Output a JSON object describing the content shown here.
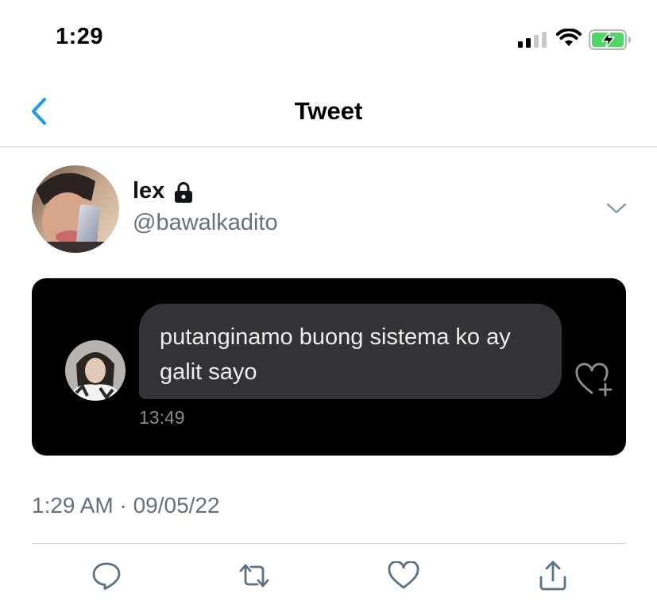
{
  "status_bar": {
    "time": "1:29",
    "icons": [
      "signal-icon",
      "wifi-icon",
      "battery-charging-icon"
    ]
  },
  "header": {
    "title": "Tweet",
    "back_icon": "chevron-left-icon",
    "accent_color": "#1d9bf0"
  },
  "tweet": {
    "author": {
      "display_name": "lex",
      "handle": "@bawalkadito",
      "protected_icon": "lock-icon"
    },
    "media": {
      "message": "putanginamo buong sistema ko ay galit sayo",
      "time": "13:49",
      "reaction_icon": "heart-plus-icon"
    },
    "timestamp": "1:29 AM · 09/05/22",
    "actions": [
      "reply-icon",
      "retweet-icon",
      "like-icon",
      "share-icon"
    ]
  }
}
